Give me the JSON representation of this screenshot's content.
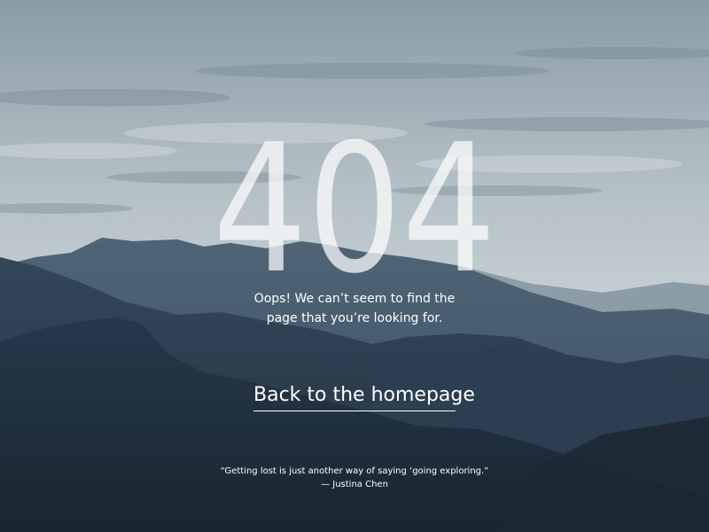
{
  "error": {
    "code": "404",
    "message": "Oops! We can’t seem to find the\npage that you’re looking for."
  },
  "nav": {
    "home_link_label": "Back to the homepage"
  },
  "quote": {
    "text": "“Getting lost is just another way of saying ‘going exploring.”",
    "author": "— Justina Chen"
  },
  "colors": {
    "sky_top": "#8fa1ab",
    "sky_bottom": "#c9d3d7",
    "mountain_dark": "#1f2d38",
    "text": "#ffffff"
  }
}
